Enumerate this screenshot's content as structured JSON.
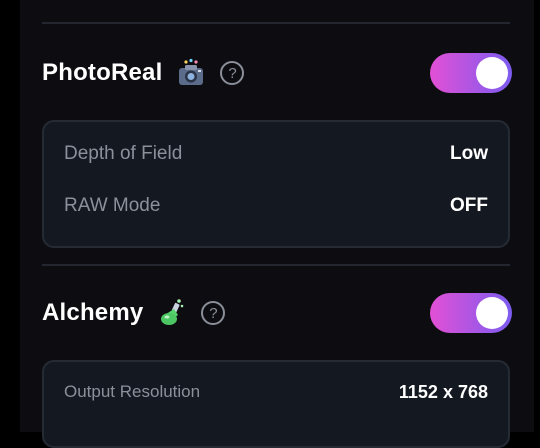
{
  "colors": {
    "toggle_start": "#e250d5",
    "toggle_end": "#7c5cf0",
    "background": "#0d0d11",
    "card": "#141821"
  },
  "photoreal": {
    "title": "PhotoReal",
    "emoji_icon": "camera-flash-icon",
    "help_symbol": "?",
    "toggle_state": "on",
    "settings": [
      {
        "label": "Depth of Field",
        "value": "Low"
      },
      {
        "label": "RAW Mode",
        "value": "OFF"
      }
    ]
  },
  "alchemy": {
    "title": "Alchemy",
    "emoji_icon": "potion-flask-icon",
    "help_symbol": "?",
    "toggle_state": "on",
    "settings": [
      {
        "label": "Output Resolution",
        "value": "1152 x 768"
      }
    ]
  }
}
